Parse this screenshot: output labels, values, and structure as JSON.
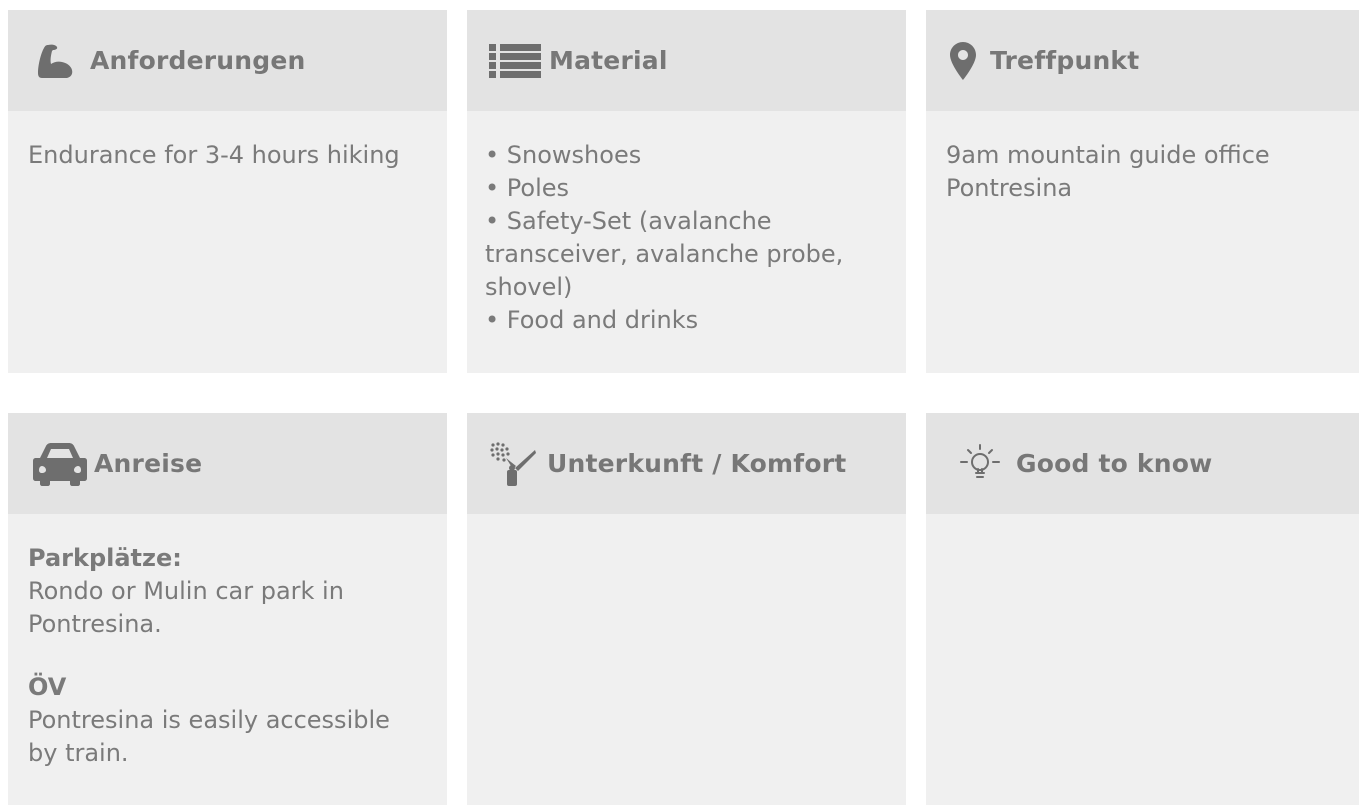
{
  "cards": {
    "requirements": {
      "icon": "flexed-bicep-icon",
      "title": "Anforderungen",
      "text": "Endurance for 3-4 hours hiking"
    },
    "material": {
      "icon": "list-icon",
      "title": "Material",
      "items": [
        "• Snowshoes",
        "• Poles",
        "• Safety-Set (avalanche",
        "transceiver, avalanche probe,",
        "shovel)",
        "• Food and drinks"
      ]
    },
    "meeting_point": {
      "icon": "map-marker-icon",
      "title": "Treffpunkt",
      "lines": [
        "9am mountain guide office",
        "Pontresina"
      ]
    },
    "arrival": {
      "icon": "car-icon",
      "title": "Anreise",
      "parking_label": "Parkplätze:",
      "parking_lines": [
        "Rondo or Mulin car park in",
        "Pontresina."
      ],
      "transit_label": "ÖV",
      "transit_lines": [
        "Pontresina is easily accessible",
        "by train."
      ]
    },
    "accommodation": {
      "icon": "shower-icon",
      "title": "Unterkunft / Komfort"
    },
    "good_to_know": {
      "icon": "lightbulb-icon",
      "title": "Good to know"
    }
  },
  "colors": {
    "header_bg": "#e3e3e3",
    "body_bg": "#f0f0f0",
    "text": "#777777"
  }
}
